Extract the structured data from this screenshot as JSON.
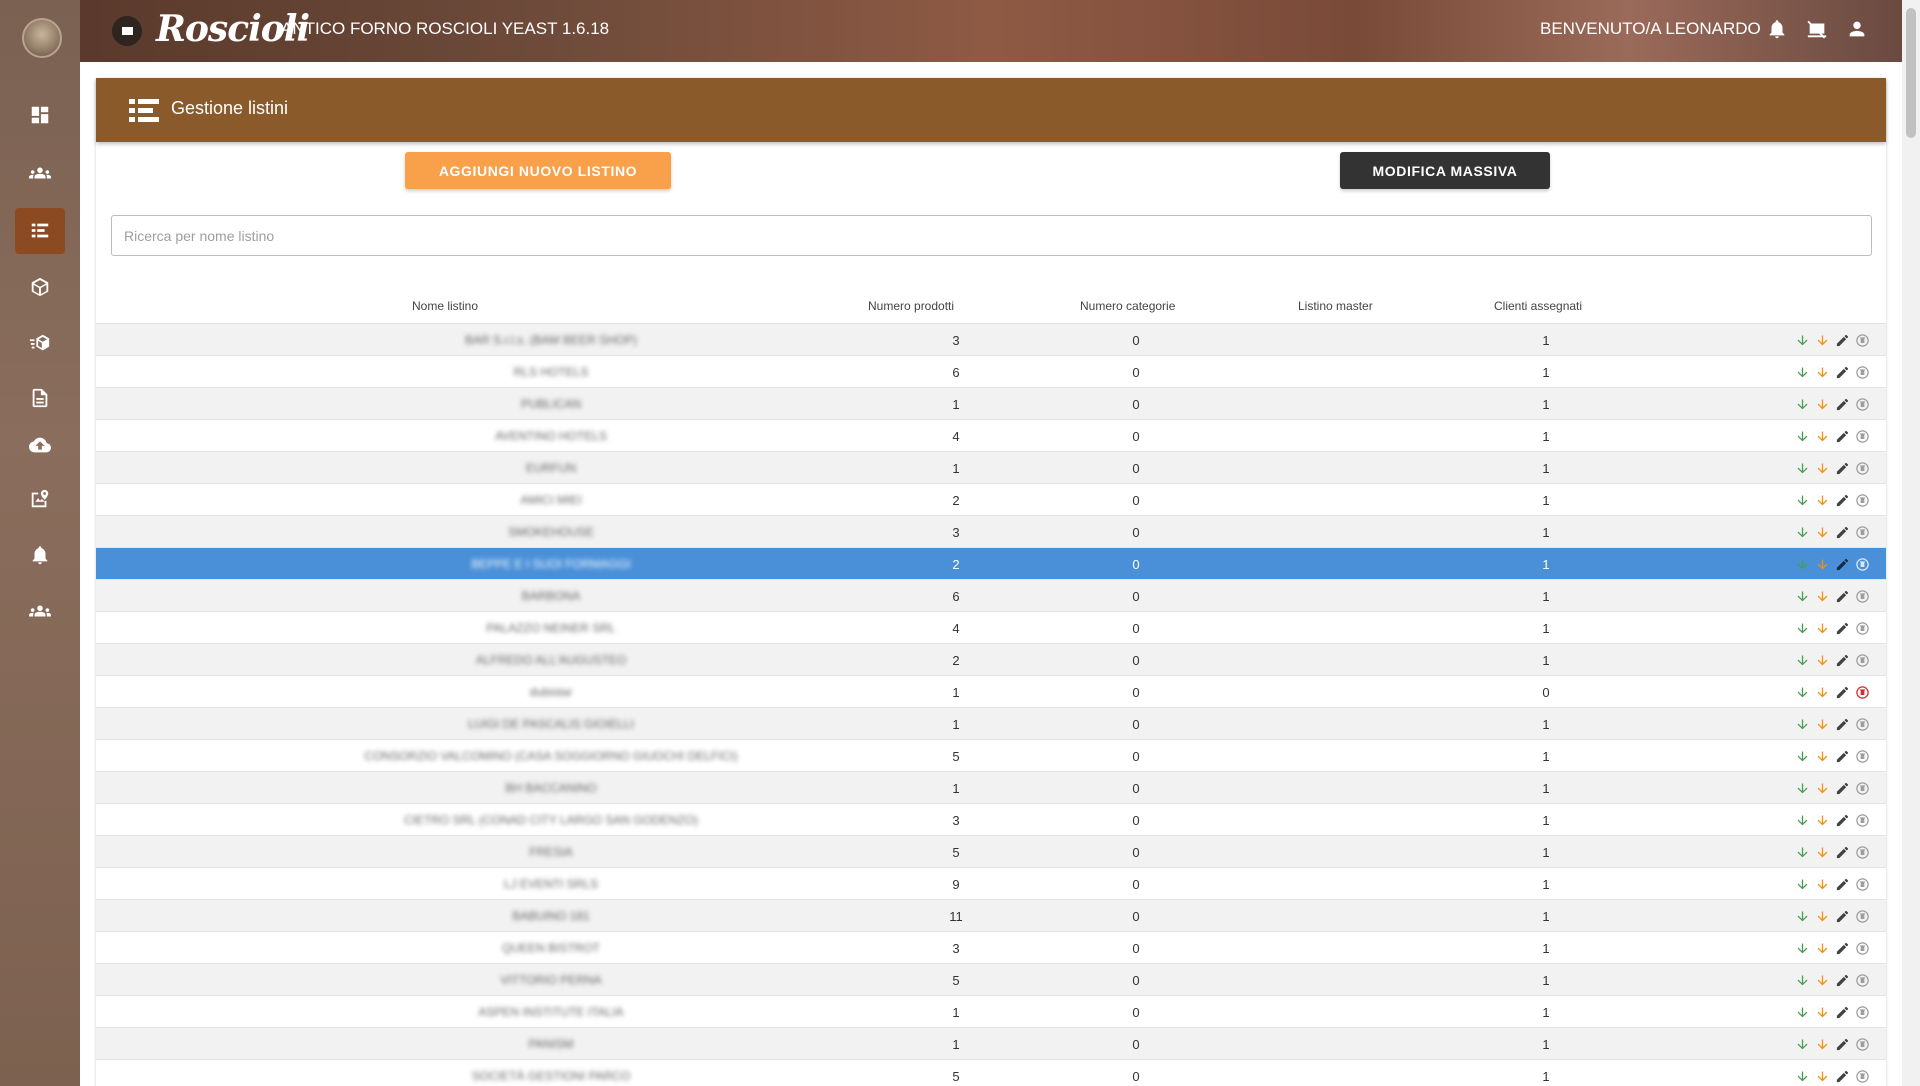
{
  "header": {
    "logo_text": "Roscioli",
    "app_title": "ANTICO FORNO ROSCIOLI YEAST 1.6.18",
    "welcome": "BENVENUTO/A LEONARDO"
  },
  "sidebar": {
    "items": [
      {
        "icon": "dashboard-icon"
      },
      {
        "icon": "users-icon"
      },
      {
        "icon": "price-list-icon",
        "active": true
      },
      {
        "icon": "box-icon"
      },
      {
        "icon": "delivery-box-icon"
      },
      {
        "icon": "document-icon"
      },
      {
        "icon": "cloud-upload-icon"
      },
      {
        "icon": "map-pin-icon"
      },
      {
        "icon": "bell-icon"
      },
      {
        "icon": "group-icon"
      }
    ]
  },
  "page": {
    "title": "Gestione listini",
    "add_button": "AGGIUNGI NUOVO LISTINO",
    "mass_edit_button": "MODIFICA MASSIVA",
    "search_placeholder": "Ricerca per nome listino"
  },
  "table": {
    "columns": [
      "Nome listino",
      "Numero prodotti",
      "Numero categorie",
      "Listino master",
      "Clienti assegnati"
    ],
    "rows": [
      {
        "name": "BAR S.r.l.s. (BAM BEER SHOP)",
        "prodotti": "3",
        "categorie": "0",
        "master": "",
        "clienti": "1"
      },
      {
        "name": "RLS HOTELS",
        "prodotti": "6",
        "categorie": "0",
        "master": "",
        "clienti": "1"
      },
      {
        "name": "PUBLICAN",
        "prodotti": "1",
        "categorie": "0",
        "master": "",
        "clienti": "1"
      },
      {
        "name": "AVENTINO HOTELS",
        "prodotti": "4",
        "categorie": "0",
        "master": "",
        "clienti": "1"
      },
      {
        "name": "EURFUN",
        "prodotti": "1",
        "categorie": "0",
        "master": "",
        "clienti": "1"
      },
      {
        "name": "AMICI MIEI",
        "prodotti": "2",
        "categorie": "0",
        "master": "",
        "clienti": "1"
      },
      {
        "name": "SMOKEHOUSE",
        "prodotti": "3",
        "categorie": "0",
        "master": "",
        "clienti": "1"
      },
      {
        "name": "BEPPE E I SUOI FORMAGGI",
        "prodotti": "2",
        "categorie": "0",
        "master": "",
        "clienti": "1",
        "selected": true
      },
      {
        "name": "BARBONA",
        "prodotti": "6",
        "categorie": "0",
        "master": "",
        "clienti": "1"
      },
      {
        "name": "PALAZZO NEINER SRL",
        "prodotti": "4",
        "categorie": "0",
        "master": "",
        "clienti": "1"
      },
      {
        "name": "ALFREDO ALL'AUGUSTEO",
        "prodotti": "2",
        "categorie": "0",
        "master": "",
        "clienti": "1"
      },
      {
        "name": "dubistar",
        "prodotti": "1",
        "categorie": "0",
        "master": "",
        "clienti": "0",
        "deletable": true
      },
      {
        "name": "LUIGI DE PASCALIS GIOIELLI",
        "prodotti": "1",
        "categorie": "0",
        "master": "",
        "clienti": "1"
      },
      {
        "name": "CONSORZIO VALCOMINO (CASA SOGGIORNO GIUOCHI DELFICI)",
        "prodotti": "5",
        "categorie": "0",
        "master": "",
        "clienti": "1"
      },
      {
        "name": "BH BACCANINO",
        "prodotti": "1",
        "categorie": "0",
        "master": "",
        "clienti": "1"
      },
      {
        "name": "CIETRO SRL (CONAD CITY LARGO SAN GODENZO)",
        "prodotti": "3",
        "categorie": "0",
        "master": "",
        "clienti": "1"
      },
      {
        "name": "FRESIA",
        "prodotti": "5",
        "categorie": "0",
        "master": "",
        "clienti": "1"
      },
      {
        "name": "LJ EVENTI SRLS",
        "prodotti": "9",
        "categorie": "0",
        "master": "",
        "clienti": "1"
      },
      {
        "name": "BABUINO 181",
        "prodotti": "11",
        "categorie": "0",
        "master": "",
        "clienti": "1"
      },
      {
        "name": "QUEEN BISTROT",
        "prodotti": "3",
        "categorie": "0",
        "master": "",
        "clienti": "1"
      },
      {
        "name": "VITTORIO PERNA",
        "prodotti": "5",
        "categorie": "0",
        "master": "",
        "clienti": "1"
      },
      {
        "name": "ASPEN INSTITUTE ITALIA",
        "prodotti": "1",
        "categorie": "0",
        "master": "",
        "clienti": "1"
      },
      {
        "name": "PANISM",
        "prodotti": "1",
        "categorie": "0",
        "master": "",
        "clienti": "1"
      },
      {
        "name": "SOCIETÀ GESTIONI PARCO",
        "prodotti": "5",
        "categorie": "0",
        "master": "",
        "clienti": "1"
      }
    ],
    "action_icons": [
      "download-green-icon",
      "download-orange-icon",
      "edit-icon",
      "delete-icon"
    ]
  },
  "colors": {
    "header_card": "#8a5a2b",
    "add_button": "#f9a04a",
    "mass_button": "#333333",
    "selected_row": "#4a90d9",
    "download_green": "#43a047",
    "download_orange": "#fb8c00",
    "delete_active": "#d32f2f"
  }
}
